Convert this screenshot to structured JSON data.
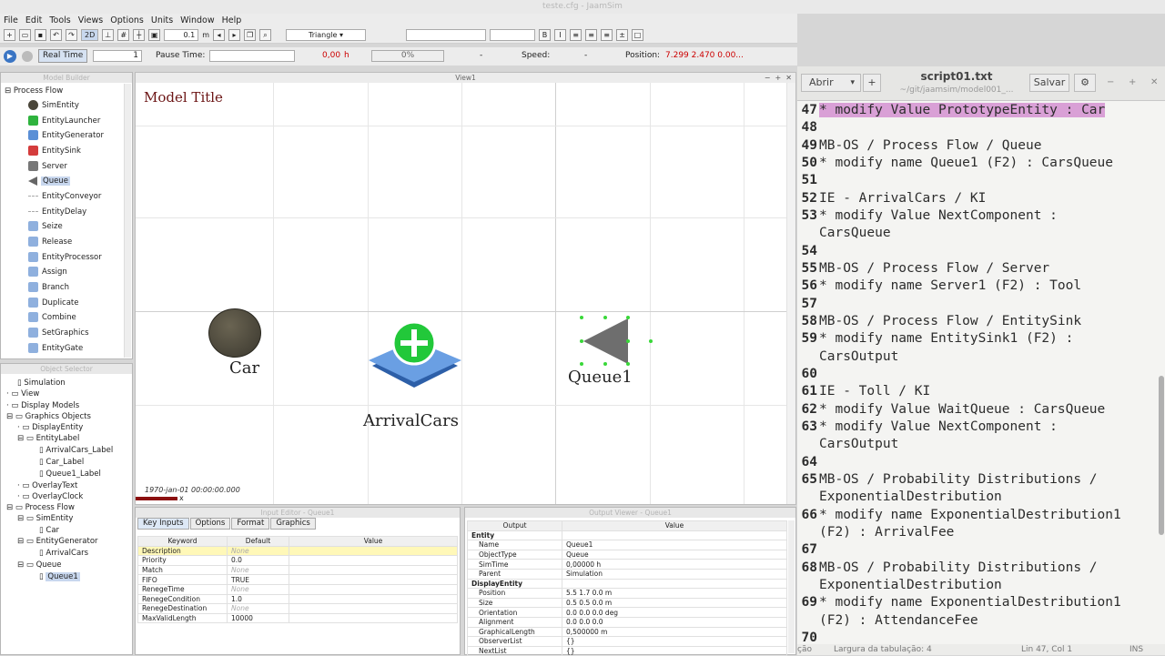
{
  "window_title": "teste.cfg - JaamSim",
  "menu": [
    "File",
    "Edit",
    "Tools",
    "Views",
    "Options",
    "Units",
    "Window",
    "Help"
  ],
  "toolbar": {
    "mode_2d": "2D",
    "increment": "0.1",
    "increment_unit": "m",
    "shape": "Triangle"
  },
  "run_bar": {
    "real_time_label": "Real Time",
    "real_time_value": "1",
    "pause_time_label": "Pause Time:",
    "sim_time": "0,00",
    "sim_time_unit": "h",
    "progress_percent": "0%",
    "dash1": "-",
    "speed_label": "Speed:",
    "dash2": "-",
    "position_label": "Position:",
    "position_value": "7.299 2.470 0.00..."
  },
  "model_builder": {
    "title": "Model Builder",
    "root": "Process Flow",
    "items": [
      "SimEntity",
      "EntityLauncher",
      "EntityGenerator",
      "EntitySink",
      "Server",
      "Queue",
      "EntityConveyor",
      "EntityDelay",
      "Seize",
      "Release",
      "EntityProcessor",
      "Assign",
      "Branch",
      "Duplicate",
      "Combine",
      "SetGraphics",
      "EntityGate"
    ]
  },
  "object_selector": {
    "title": "Object Selector",
    "rows": [
      "Simulation",
      "View",
      "Display Models",
      "Graphics Objects",
      "DisplayEntity",
      "EntityLabel",
      "ArrivalCars_Label",
      "Car_Label",
      "Queue1_Label",
      "OverlayText",
      "OverlayClock",
      "Process Flow",
      "SimEntity",
      "Car",
      "EntityGenerator",
      "ArrivalCars",
      "Queue",
      "Queue1"
    ]
  },
  "view": {
    "tab_title": "View1",
    "model_title": "Model Title",
    "car_label": "Car",
    "arrival_label": "ArrivalCars",
    "queue_label": "Queue1",
    "clock": "1970-jan-01  00:00:00.000",
    "axis_x": "x"
  },
  "input_editor": {
    "title": "Input Editor - Queue1",
    "tabs": [
      "Key Inputs",
      "Options",
      "Format",
      "Graphics"
    ],
    "headers": [
      "Keyword",
      "Default",
      "Value"
    ],
    "rows": [
      [
        "Description",
        "None",
        ""
      ],
      [
        "Priority",
        "0.0",
        ""
      ],
      [
        "Match",
        "None",
        ""
      ],
      [
        "FIFO",
        "TRUE",
        ""
      ],
      [
        "RenegeTime",
        "None",
        ""
      ],
      [
        "RenegeCondition",
        "1.0",
        ""
      ],
      [
        "RenegeDestination",
        "None",
        ""
      ],
      [
        "MaxValidLength",
        "10000",
        ""
      ]
    ]
  },
  "output_viewer": {
    "title": "Output Viewer - Queue1",
    "headers": [
      "Output",
      "Value"
    ],
    "rows": [
      [
        "Entity",
        ""
      ],
      [
        "Name",
        "Queue1"
      ],
      [
        "ObjectType",
        "Queue"
      ],
      [
        "SimTime",
        "0,00000  h"
      ],
      [
        "Parent",
        "Simulation"
      ],
      [
        "DisplayEntity",
        ""
      ],
      [
        "Position",
        "5.5  1.7  0.0  m"
      ],
      [
        "Size",
        "0.5  0.5  0.0  m"
      ],
      [
        "Orientation",
        "0.0  0.0  0.0  deg"
      ],
      [
        "Alignment",
        "0.0  0.0  0.0"
      ],
      [
        "GraphicalLength",
        "0,500000  m"
      ],
      [
        "ObserverList",
        "{}"
      ],
      [
        "NextList",
        "{}"
      ]
    ]
  },
  "editor": {
    "open_label": "Abrir",
    "save_label": "Salvar",
    "filename": "script01.txt",
    "path": "~/git/jaamsim/model001_...",
    "status_tab": "Largura da tabulação: 4",
    "status_pos": "Lin 47, Col 1",
    "status_ins": "INS",
    "status_left": "ção",
    "lines": [
      {
        "n": "47",
        "t": "* modify Value PrototypeEntity : Car",
        "hl": true
      },
      {
        "n": "48",
        "t": ""
      },
      {
        "n": "49",
        "t": "MB-OS / Process Flow / Queue"
      },
      {
        "n": "50",
        "t": "* modify name Queue1 (F2) : CarsQueue"
      },
      {
        "n": "51",
        "t": ""
      },
      {
        "n": "52",
        "t": "IE - ArrivalCars / KI"
      },
      {
        "n": "53",
        "t": "* modify Value NextComponent :"
      },
      {
        "n": "",
        "t": "CarsQueue"
      },
      {
        "n": "54",
        "t": ""
      },
      {
        "n": "55",
        "t": "MB-OS / Process Flow / Server"
      },
      {
        "n": "56",
        "t": "* modify name Server1 (F2) : Tool"
      },
      {
        "n": "57",
        "t": ""
      },
      {
        "n": "58",
        "t": "MB-OS / Process Flow / EntitySink"
      },
      {
        "n": "59",
        "t": "* modify name EntitySink1 (F2) :"
      },
      {
        "n": "",
        "t": "CarsOutput"
      },
      {
        "n": "60",
        "t": ""
      },
      {
        "n": "61",
        "t": "IE - Toll / KI"
      },
      {
        "n": "62",
        "t": "* modify Value WaitQueue : CarsQueue"
      },
      {
        "n": "63",
        "t": "* modify Value NextComponent :"
      },
      {
        "n": "",
        "t": "CarsOutput"
      },
      {
        "n": "64",
        "t": ""
      },
      {
        "n": "65",
        "t": "MB-OS / Probability Distributions /"
      },
      {
        "n": "",
        "t": "ExponentialDestribution"
      },
      {
        "n": "66",
        "t": "* modify name ExponentialDestribution1"
      },
      {
        "n": "",
        "t": "(F2) : ArrivalFee"
      },
      {
        "n": "67",
        "t": ""
      },
      {
        "n": "68",
        "t": "MB-OS / Probability Distributions /"
      },
      {
        "n": "",
        "t": "ExponentialDestribution"
      },
      {
        "n": "69",
        "t": "* modify name ExponentialDestribution1"
      },
      {
        "n": "",
        "t": "(F2) : AttendanceFee"
      },
      {
        "n": "70",
        "t": ""
      }
    ]
  }
}
